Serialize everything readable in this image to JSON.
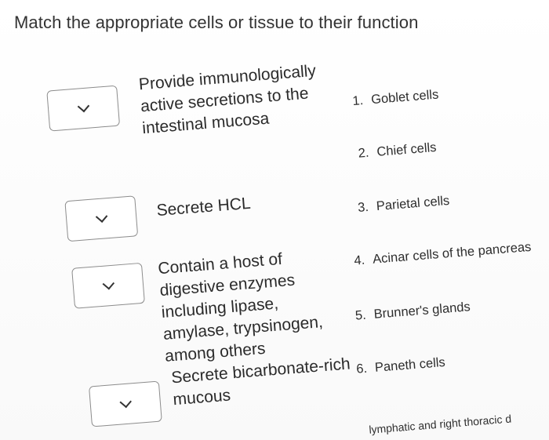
{
  "question": {
    "title": "Match the appropriate cells or tissue to their function"
  },
  "prompts": [
    {
      "text": "Provide immunologically active secretions to the intestinal mucosa"
    },
    {
      "text": "Secrete HCL"
    },
    {
      "text": "Contain a host of digestive enzymes including lipase, amylase, trypsinogen, among others"
    },
    {
      "text": "Secrete bicarbonate-rich mucous"
    }
  ],
  "options": [
    {
      "num": "1.",
      "label": "Goblet cells"
    },
    {
      "num": "2.",
      "label": "Chief cells"
    },
    {
      "num": "3.",
      "label": "Parietal cells"
    },
    {
      "num": "4.",
      "label": "Acinar cells of the pancreas"
    },
    {
      "num": "5.",
      "label": "Brunner's glands"
    },
    {
      "num": "6.",
      "label": "Paneth cells"
    },
    {
      "num": "",
      "label": "lymphatic and right thoracic d"
    }
  ],
  "icons": {
    "dropdown": "chevron-down-icon"
  }
}
